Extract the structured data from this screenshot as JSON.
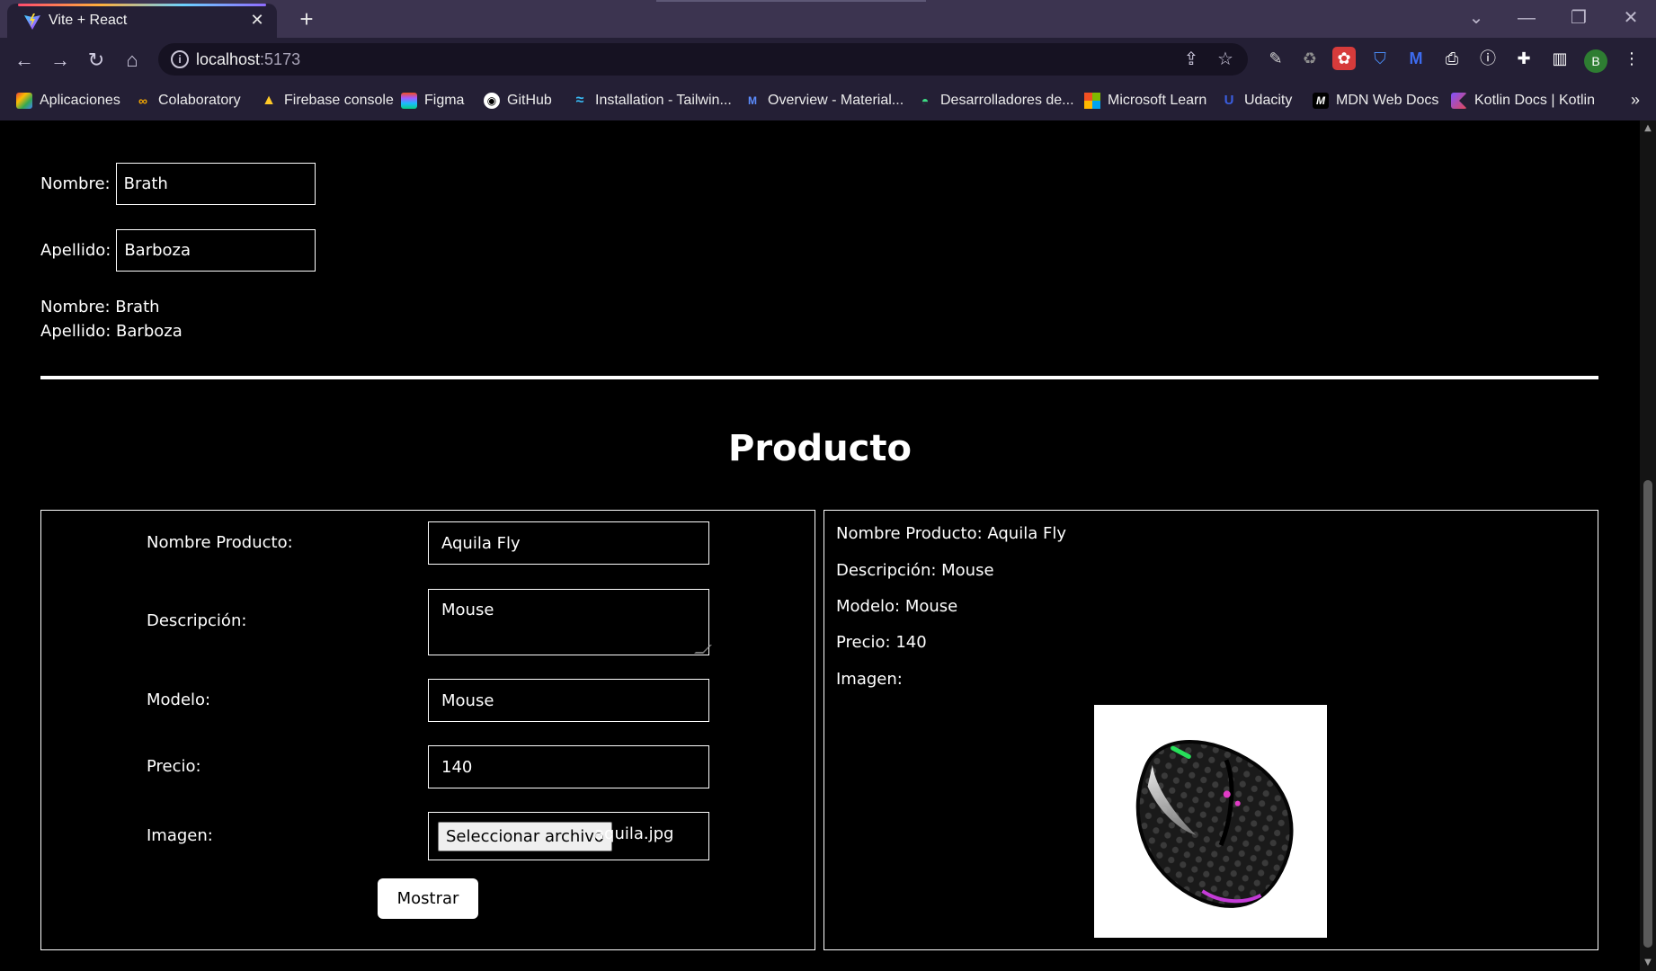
{
  "browser": {
    "tab_title": "Vite + React",
    "url_host": "localhost",
    "url_port": ":5173",
    "profile_initial": "B",
    "bookmarks": [
      {
        "label": "Aplicaciones",
        "icon": "apps-grid-icon",
        "color": "#e8a33d"
      },
      {
        "label": "Colaboratory",
        "icon": "colab-icon",
        "color": "#f9ab00"
      },
      {
        "label": "Firebase console",
        "icon": "firebase-icon",
        "color": "#ffca28"
      },
      {
        "label": "Figma",
        "icon": "figma-icon",
        "color": "#f24e1e"
      },
      {
        "label": "GitHub",
        "icon": "github-icon",
        "color": "#ffffff"
      },
      {
        "label": "Installation - Tailwin...",
        "icon": "tailwind-icon",
        "color": "#38bdf8"
      },
      {
        "label": "Overview - Material...",
        "icon": "material-icon",
        "color": "#5c8dff"
      },
      {
        "label": "Desarrolladores de...",
        "icon": "android-icon",
        "color": "#3ddc84"
      },
      {
        "label": "Microsoft Learn",
        "icon": "microsoft-icon",
        "color": "#f25022"
      },
      {
        "label": "Udacity",
        "icon": "udacity-icon",
        "color": "#3a5ee0"
      },
      {
        "label": "MDN Web Docs",
        "icon": "mdn-icon",
        "color": "#000000"
      },
      {
        "label": "Kotlin Docs | Kotlin",
        "icon": "kotlin-icon",
        "color": "#b125ea"
      }
    ]
  },
  "person_form": {
    "nombre_label": "Nombre:",
    "nombre_value": "Brath",
    "apellido_label": "Apellido:",
    "apellido_value": "Barboza",
    "out_nombre": "Nombre: Brath",
    "out_apellido": "Apellido: Barboza"
  },
  "product": {
    "title": "Producto",
    "form": {
      "nombre_label": "Nombre Producto:",
      "nombre_value": "Aquila Fly",
      "descripcion_label": "Descripción:",
      "descripcion_value": "Mouse",
      "modelo_label": "Modelo:",
      "modelo_value": "Mouse",
      "precio_label": "Precio:",
      "precio_value": "140",
      "imagen_label": "Imagen:",
      "file_button": "Seleccionar archivo",
      "file_name": "aquila.jpg",
      "submit_label": "Mostrar"
    },
    "display": {
      "nombre": "Nombre Producto: Aquila Fly",
      "descripcion": "Descripción: Mouse",
      "modelo": "Modelo: Mouse",
      "precio": "Precio: 140",
      "imagen": "Imagen:"
    }
  }
}
